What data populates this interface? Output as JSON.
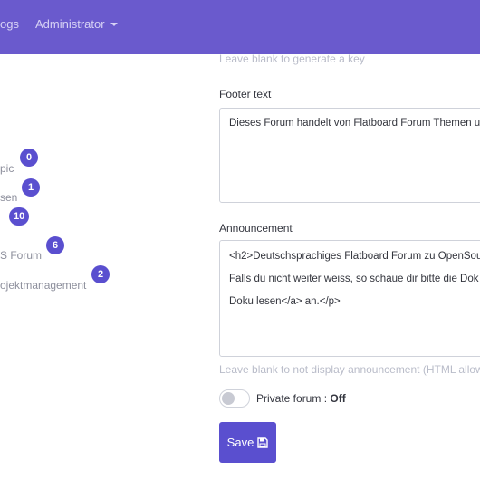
{
  "navbar": {
    "blogs_label": "ogs",
    "admin_label": "Administrator"
  },
  "categories": [
    {
      "label": "pic",
      "count": "0"
    },
    {
      "label": "sen",
      "count": "1"
    },
    {
      "label": "",
      "count": "10"
    },
    {
      "label": "S Forum",
      "count": "6"
    },
    {
      "label": "ojektmanagement",
      "count": "2"
    }
  ],
  "form": {
    "key_help": "Leave blank to generate a key",
    "footer_label": "Footer text",
    "footer_value": "Dieses Forum handelt von Flatboard Forum Themen u",
    "announcement_label": "Announcement",
    "announcement_lines": [
      "<h2>Deutschsprachiges Flatboard Forum zu OpenSou",
      "Falls du nicht weiter weiss, so schaue dir bitte die Dok",
      "Doku lesen</a> an.</p>"
    ],
    "announcement_help": "Leave blank to not display announcement (HTML allowe",
    "private_label": "Private forum :",
    "private_value": "Off",
    "private_enabled": false,
    "save_label": "Save"
  },
  "colors": {
    "navbar": "#6a5acd",
    "accent": "#5a4fcf"
  },
  "icons": {
    "save": "floppy-disk-icon",
    "dropdown": "caret-down-icon"
  }
}
